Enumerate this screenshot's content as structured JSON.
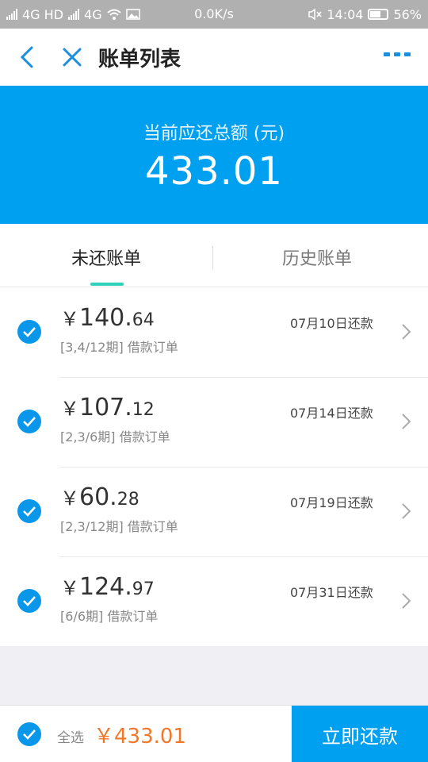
{
  "status_bar": {
    "network_left": "4G HD",
    "network_right": "4G",
    "speed": "0.0K/s",
    "time": "14:04",
    "battery": "56%"
  },
  "nav": {
    "title": "账单列表"
  },
  "banner": {
    "label": "当前应还总额 (元)",
    "amount": "433.01"
  },
  "tabs": [
    {
      "label": "未还账单",
      "active": true
    },
    {
      "label": "历史账单",
      "active": false
    }
  ],
  "bills": [
    {
      "yen": "￥",
      "int": "140.",
      "dec": "64",
      "desc": "[3,4/12期] 借款订单",
      "date": "07月10日还款",
      "checked": true
    },
    {
      "yen": "￥",
      "int": "107.",
      "dec": "12",
      "desc": "[2,3/6期] 借款订单",
      "date": "07月14日还款",
      "checked": true
    },
    {
      "yen": "￥",
      "int": "60.",
      "dec": "28",
      "desc": "[2,3/12期] 借款订单",
      "date": "07月19日还款",
      "checked": true
    },
    {
      "yen": "￥",
      "int": "124.",
      "dec": "97",
      "desc": "[6/6期] 借款订单",
      "date": "07月31日还款",
      "checked": true
    }
  ],
  "footer": {
    "select_all_label": "全选",
    "total": "￥433.01",
    "pay_button": "立即还款"
  },
  "colors": {
    "primary": "#00a0f0",
    "accent_orange": "#f0782a",
    "tab_indicator": "#2fd3bc"
  }
}
